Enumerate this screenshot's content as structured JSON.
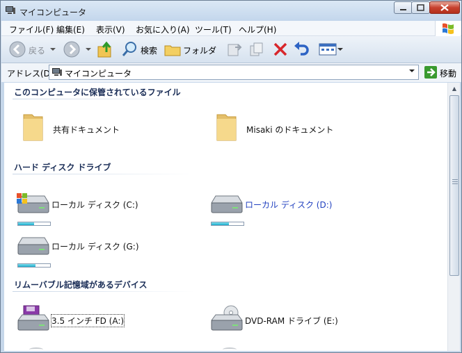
{
  "window": {
    "title": "マイコンピュータ"
  },
  "menu": [
    "ファイル(F)",
    "編集(E)",
    "表示(V)",
    "お気に入り(A)",
    "ツール(T)",
    "ヘルプ(H)"
  ],
  "toolbar": {
    "back_label": "戻る",
    "search_label": "検索",
    "folders_label": "フォルダ"
  },
  "address": {
    "label": "アドレス(D)",
    "value": "マイコンピュータ",
    "go_label": "移動"
  },
  "groups": {
    "files": {
      "header": "このコンピュータに保管されているファイル",
      "items": [
        {
          "label": "共有ドキュメント",
          "icon": "folder-icon"
        },
        {
          "label": "Misaki のドキュメント",
          "icon": "folder-icon"
        }
      ]
    },
    "hdd": {
      "header": "ハード ディスク ドライブ",
      "items": [
        {
          "label": "ローカル ディスク (C:)",
          "icon": "system-drive-icon",
          "usage": 0.5,
          "color": "#111111"
        },
        {
          "label": "ローカル ディスク (D:)",
          "icon": "hard-drive-icon",
          "usage": 0.55,
          "color": "#1f3fbf"
        },
        {
          "label": "ローカル ディスク (G:)",
          "icon": "hard-drive-icon",
          "usage": 0.55,
          "color": "#111111"
        }
      ]
    },
    "removable": {
      "header": "リムーバブル記憶域があるデバイス",
      "items": [
        {
          "label": "3.5 インチ FD (A:)",
          "icon": "floppy-drive-icon"
        },
        {
          "label": "DVD-RAM ドライブ (E:)",
          "icon": "dvd-drive-icon"
        }
      ]
    }
  }
}
